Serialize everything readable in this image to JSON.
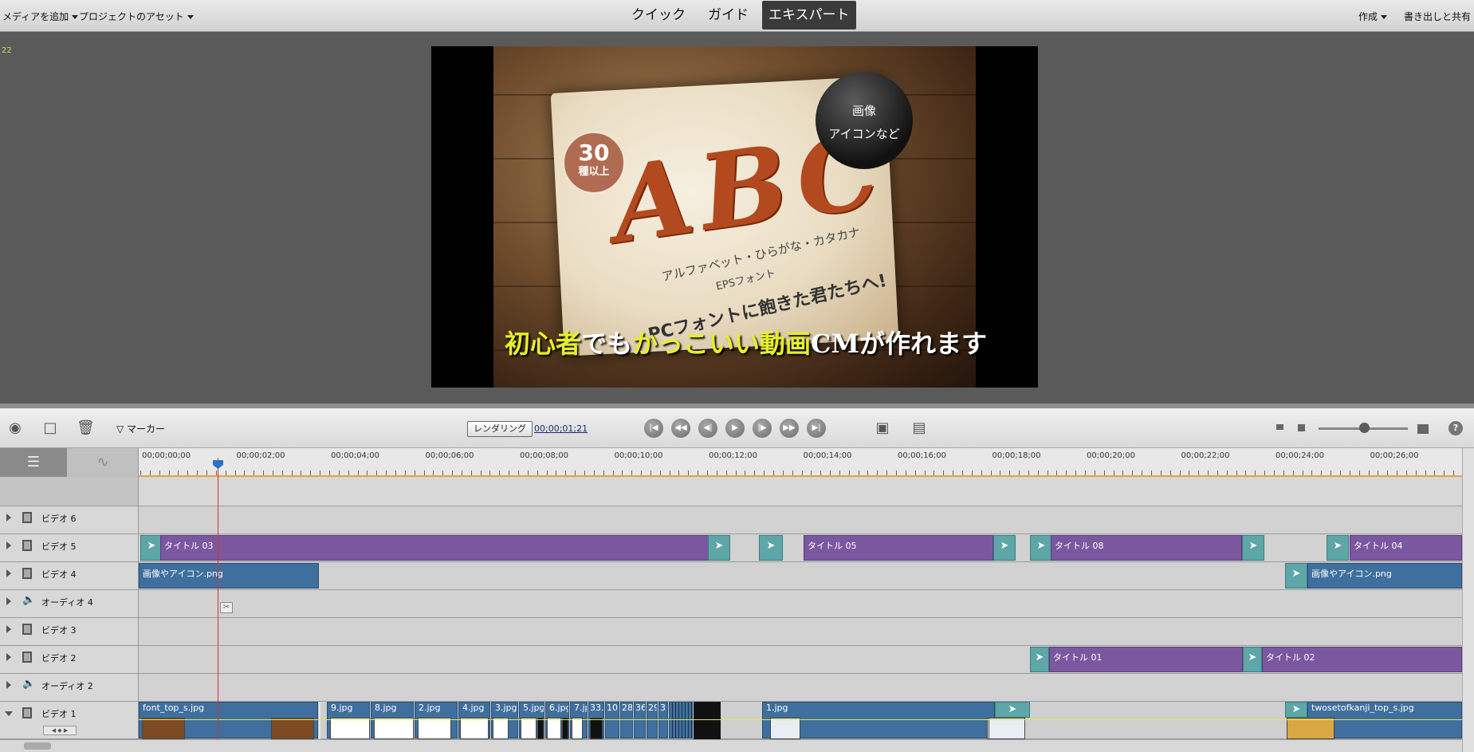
{
  "topbar": {
    "add_media": "メディアを追加",
    "project_assets": "プロジェクトのアセット",
    "tabs": [
      "クイック",
      "ガイド",
      "エキスパート"
    ],
    "create": "作成",
    "export_share": "書き出しと共有"
  },
  "monitor": {
    "frame_number": "22",
    "badge_number": "30",
    "badge_sub": "種以上",
    "circle_line1": "画像",
    "circle_line2": "アイコンなど",
    "big_letters": "ABC",
    "paper_line1": "アルファベット・ひらがな・カタカナ",
    "paper_line2": "EPSフォント",
    "paper_line3": "PCフォントに飽きた君たちへ!",
    "caption_a": "初心者",
    "caption_b": "でも",
    "caption_c": "かっこいい動画",
    "caption_d": "CMが作れます"
  },
  "toolbar": {
    "marker": "マーカー",
    "render": "レンダリング",
    "timecode": "00;00;01;21",
    "help": "?"
  },
  "ruler": {
    "labels": [
      "00;00;00;00",
      "00;00;02;00",
      "00;00;04;00",
      "00;00;06;00",
      "00;00;08;00",
      "00;00;10;00",
      "00;00;12;00",
      "00;00;14;00",
      "00;00;16;00",
      "00;00;18;00",
      "00;00;20;00",
      "00;00;22;00",
      "00;00;24;00",
      "00;00;26;00"
    ]
  },
  "tracks": {
    "video6": "ビデオ 6",
    "video5": "ビデオ 5",
    "video4": "ビデオ 4",
    "audio4": "オーディオ 4",
    "video3": "ビデオ 3",
    "video2": "ビデオ 2",
    "audio2": "オーディオ 2",
    "video1": "ビデオ 1"
  },
  "clips": {
    "v5_title03": "タイトル 03",
    "v5_title05": "タイトル 05",
    "v5_title08": "タイトル 08",
    "v5_title04": "タイトル 04",
    "v4_img1": "画像やアイコン.png",
    "v4_img2": "画像やアイコン.png",
    "v2_title01": "タイトル 01",
    "v2_title02": "タイトル 02",
    "v1_font_top": "font_top_s.jpg",
    "v1_9": "9.jpg",
    "v1_8": "8.jpg",
    "v1_2": "2.jpg",
    "v1_4": "4.jpg",
    "v1_3": "3.jpg",
    "v1_5": "5.jpg",
    "v1_6": "6.jpg",
    "v1_7": "7.jp",
    "v1_33": "33.",
    "v1_10": "10",
    "v1_28": "28",
    "v1_36": "36",
    "v1_29": "29",
    "v1_3b": "3",
    "v1_1": "1.jpg",
    "v1_twosetof": "twosetofkanji_top_s.jpg"
  },
  "colors": {
    "title_clip": "#7b57a0",
    "image_clip": "#3f6f9e",
    "transition": "#5ea6a8",
    "playhead": "#d9322b",
    "caption_yellow": "#e5ef2c"
  }
}
